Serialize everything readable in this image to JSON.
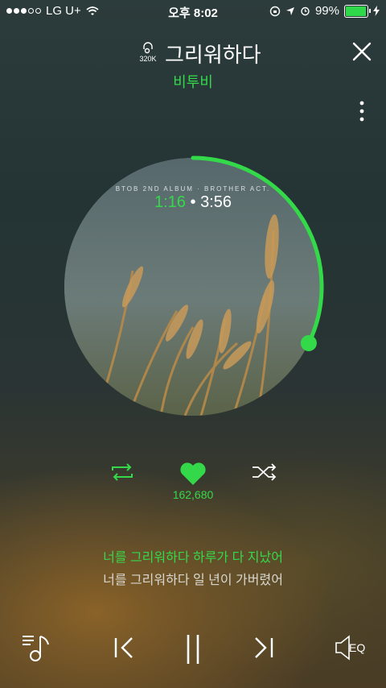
{
  "status_bar": {
    "carrier": "LG U+",
    "time": "오후 8:02",
    "battery": "99%",
    "signal_strength": 3
  },
  "header": {
    "quality": "320K",
    "title": "그리워하다",
    "artist": "비투비"
  },
  "album": {
    "caption": "BTOB 2ND ALBUM · BROTHER ACT.",
    "current_time": "1:16",
    "separator": "•",
    "total_time": "3:56",
    "progress": 0.322
  },
  "controls": {
    "like_count": "162,680"
  },
  "lyrics": {
    "current": "너를 그리워하다 하루가 다 지났어",
    "next": "너를 그리워하다 일 년이 가버렸어"
  },
  "bottom_bar": {
    "eq_label": "EQ"
  },
  "colors": {
    "accent": "#34d94a"
  }
}
